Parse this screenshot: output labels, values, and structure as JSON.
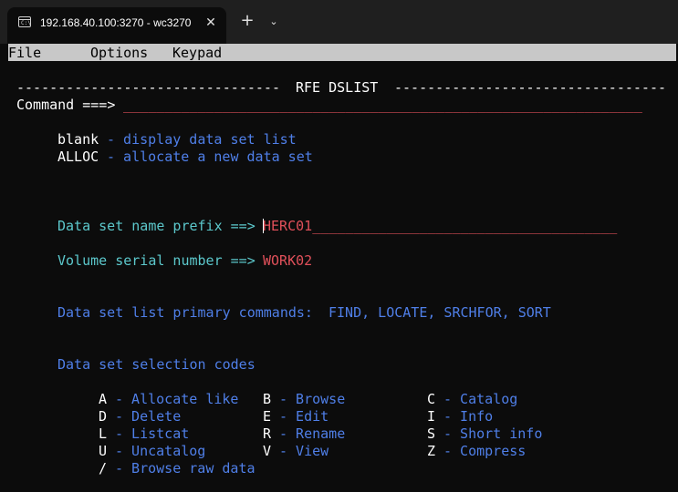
{
  "window": {
    "tab_title": "192.168.40.100:3270 - wc3270",
    "close_glyph": "✕",
    "new_tab_glyph": "+",
    "dropdown_glyph": "⌄"
  },
  "menu": {
    "file": "File",
    "options": "Options",
    "keypad": "Keypad"
  },
  "screen": {
    "header_left_rule": "--------------------------------",
    "header_title": "RFE DSLIST",
    "header_right_rule": "---------------------------------",
    "command_label": "Command ===>",
    "command_field": "_______________________________________________________________",
    "help": [
      {
        "key": "blank",
        "desc": "- display data set list"
      },
      {
        "key": "ALLOC",
        "desc": "- allocate a new data set"
      }
    ],
    "prefix_label": "Data set name prefix ==>",
    "prefix_value": "HERC01",
    "prefix_fill": "_____________________________________",
    "volume_label": "Volume serial number ==>",
    "volume_value": "WORK02",
    "primary_cmds_label": "Data set list primary commands:",
    "primary_cmds": "FIND, LOCATE, SRCHFOR, SORT",
    "selection_header": "Data set selection codes",
    "codes": [
      {
        "code": "A",
        "desc": "- Allocate like"
      },
      {
        "code": "B",
        "desc": "- Browse"
      },
      {
        "code": "C",
        "desc": "- Catalog"
      },
      {
        "code": "D",
        "desc": "- Delete"
      },
      {
        "code": "E",
        "desc": "- Edit"
      },
      {
        "code": "I",
        "desc": "- Info"
      },
      {
        "code": "L",
        "desc": "- Listcat"
      },
      {
        "code": "R",
        "desc": "- Rename"
      },
      {
        "code": "S",
        "desc": "- Short info"
      },
      {
        "code": "U",
        "desc": "- Uncatalog"
      },
      {
        "code": "V",
        "desc": "- View"
      },
      {
        "code": "Z",
        "desc": "- Compress"
      },
      {
        "code": "/",
        "desc": "- Browse raw data"
      }
    ]
  },
  "colors": {
    "background": "#0c0c0c",
    "white": "#ffffff",
    "blue": "#4f7fe8",
    "cyan": "#5cc8cc",
    "red": "#e0505a",
    "menubar": "#c8c8c8"
  }
}
